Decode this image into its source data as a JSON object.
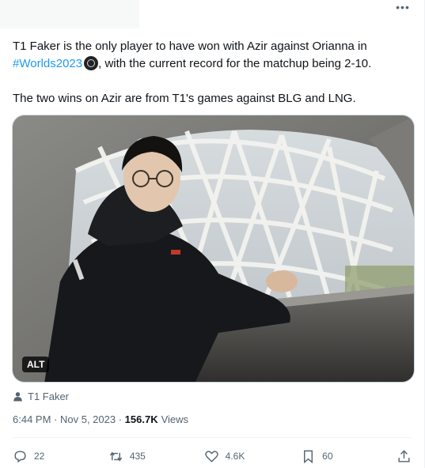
{
  "tweet": {
    "text_line1_part1": "T1 Faker is the only player to have won with Azir against Orianna in",
    "hashtag": "#Worlds2023",
    "text_line2_rest": ", with the current record for the matchup being 2-10.",
    "text_paragraph2": "The two wins on Azir are from T1's games against BLG and LNG."
  },
  "media": {
    "alt_label": "ALT"
  },
  "tagged": {
    "name": "T1 Faker"
  },
  "meta": {
    "time": "6:44 PM",
    "separator1": " · ",
    "date": "Nov 5, 2023",
    "separator2": " · ",
    "views_count": "156.7K",
    "views_label": "Views"
  },
  "actions": {
    "replies": "22",
    "reposts": "435",
    "likes": "4.6K",
    "bookmarks": "60"
  },
  "icons": {
    "more": "more-horizontal-icon",
    "reply": "reply-icon",
    "repost": "repost-icon",
    "like": "heart-icon",
    "bookmark": "bookmark-icon",
    "share": "share-icon",
    "person": "person-icon",
    "hashflag": "worlds-hashflag-icon"
  },
  "colors": {
    "link": "#1d9bf0",
    "secondary_text": "#536471",
    "primary_text": "#0f1419"
  }
}
